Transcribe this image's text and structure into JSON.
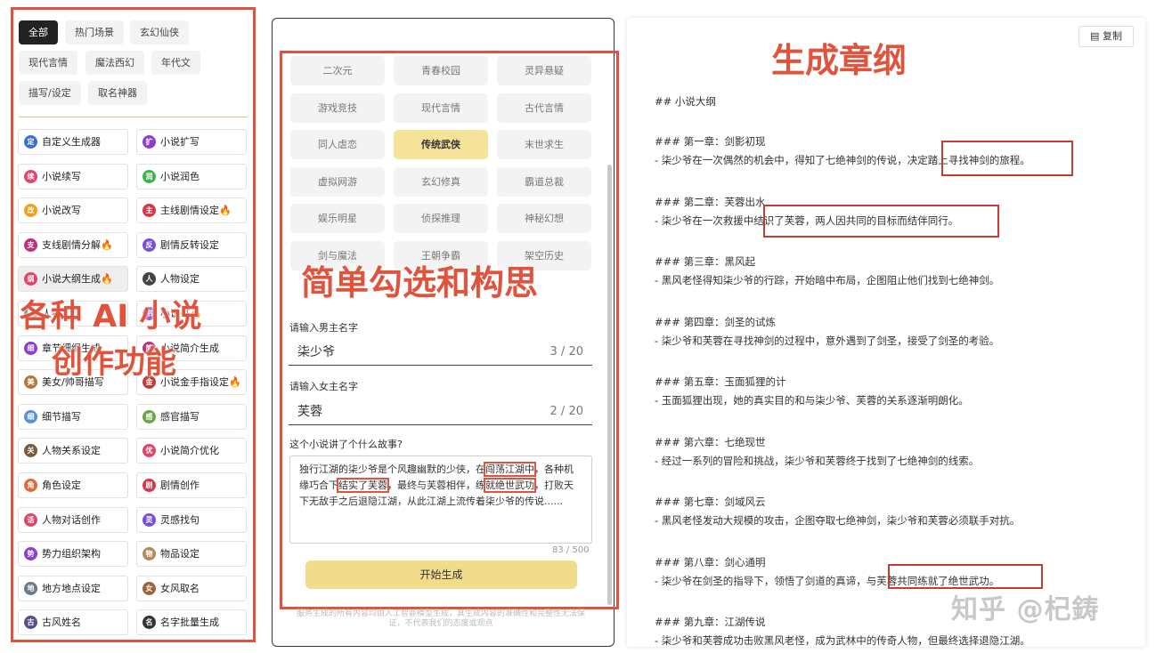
{
  "left": {
    "categories": [
      "全部",
      "热门场景",
      "玄幻仙侠",
      "现代言情",
      "魔法西幻",
      "年代文",
      "描写/设定",
      "取名神器"
    ],
    "tools": [
      {
        "label": "自定义生成器",
        "icon": "定",
        "color": "#3b6ed6"
      },
      {
        "label": "小说扩写",
        "icon": "扩",
        "color": "#8a3fd1"
      },
      {
        "label": "小说续写",
        "icon": "续",
        "color": "#e0446a"
      },
      {
        "label": "小说润色",
        "icon": "润",
        "color": "#3bb54a"
      },
      {
        "label": "小说改写",
        "icon": "改",
        "color": "#f0a01c"
      },
      {
        "label": "主线剧情设定",
        "icon": "主",
        "color": "#d9364a",
        "fire": "🔥"
      },
      {
        "label": "支线剧情分解",
        "icon": "支",
        "color": "#c0307a",
        "fire": "🔥"
      },
      {
        "label": "剧情反转设定",
        "icon": "反",
        "color": "#7a4fd6"
      },
      {
        "label": "小说大纲生成",
        "icon": "纲",
        "color": "#e0446a",
        "fire": "🔥"
      },
      {
        "label": "人物设定",
        "icon": "人",
        "color": "#444"
      },
      {
        "label": "人物",
        "icon": "物",
        "color": "#666"
      },
      {
        "label": "小说书",
        "icon": "书",
        "color": "#9a4fd6",
        "fire": "🔥"
      },
      {
        "label": "章节细纲生成",
        "icon": "细",
        "color": "#8a3fd1"
      },
      {
        "label": "小说简介生成",
        "icon": "简",
        "color": "#c0307a"
      },
      {
        "label": "美女/帅哥描写",
        "icon": "美",
        "color": "#b07a3c"
      },
      {
        "label": "小说金手指设定",
        "icon": "金",
        "color": "#c23a3a",
        "fire": "🔥"
      },
      {
        "label": "细节描写",
        "icon": "细",
        "color": "#5a8fd6"
      },
      {
        "label": "感官描写",
        "icon": "感",
        "color": "#6aa34a"
      },
      {
        "label": "人物关系设定",
        "icon": "关",
        "color": "#7a5a3c"
      },
      {
        "label": "小说简介优化",
        "icon": "优",
        "color": "#e0446a"
      },
      {
        "label": "角色设定",
        "icon": "角",
        "color": "#e06a3c"
      },
      {
        "label": "剧情创作",
        "icon": "剧",
        "color": "#d9364a"
      },
      {
        "label": "人物对话创作",
        "icon": "话",
        "color": "#e0446a"
      },
      {
        "label": "灵感找句",
        "icon": "灵",
        "color": "#7a4fd6"
      },
      {
        "label": "势力组织架构",
        "icon": "势",
        "color": "#8a3fd1"
      },
      {
        "label": "物品设定",
        "icon": "物",
        "color": "#b08a5a"
      },
      {
        "label": "地方地点设定",
        "icon": "地",
        "color": "#6a7a8a"
      },
      {
        "label": "女风取名",
        "icon": "女",
        "color": "#a0603c"
      },
      {
        "label": "古风姓名",
        "icon": "古",
        "color": "#5a4f8a"
      },
      {
        "label": "名字批量生成",
        "icon": "名",
        "color": "#333"
      }
    ],
    "overlay_line1": "各种 AI 小说",
    "overlay_line2": "创作功能"
  },
  "middle": {
    "genres": [
      "二次元",
      "青春校园",
      "灵异悬疑",
      "游戏竞技",
      "现代言情",
      "古代言情",
      "同人虐恋",
      "传统武侠",
      "末世求生",
      "虚拟网游",
      "玄幻修真",
      "霸道总裁",
      "娱乐明星",
      "侦探推理",
      "神秘幻想",
      "剑与魔法",
      "王朝争霸",
      "架空历史"
    ],
    "selected_genre": "传统武侠",
    "overlay": "简单勾选和构思",
    "male_label": "请输入男主名字",
    "male_value": "柒少爷",
    "male_count": "3 / 20",
    "female_label": "请输入女主名字",
    "female_value": "芙蓉",
    "female_count": "2 / 20",
    "story_label": "这个小说讲了个什么故事?",
    "story_p1": "独行江湖的柒少爷是个风趣幽默的少侠，在",
    "story_h1": "闯荡江湖中",
    "story_p2": "，各种机缘巧合下",
    "story_h2": "结实了芙蓉",
    "story_p3": "，最终与芙蓉相伴，练",
    "story_h3": "就绝世武功",
    "story_p4": "，打败天下无敌手之后退隐江湖，从此江湖上流传着柒少爷的传说......",
    "story_count": "83 / 500",
    "generate_label": "开始生成",
    "disclaimer": "服务生成的所有内容均由人工智能模型生成，其生成内容的准确性和完整性无法保证，不代表我们的态度或观点"
  },
  "right": {
    "copy_label": "复制",
    "overlay": "生成章纲",
    "outline_title": "## 小说大纲",
    "chapters": [
      {
        "h": "### 第一章：剑影初现",
        "d": "- 柒少爷在一次偶然的机会中，得知了七绝神剑的传说，决定踏上寻找神剑的旅程。"
      },
      {
        "h": "### 第二章：芙蓉出水",
        "d": "- 柒少爷在一次救援中结识了芙蓉，两人因共同的目标而结伴同行。"
      },
      {
        "h": "### 第三章：黑风起",
        "d": "- 黑风老怪得知柒少爷的行踪，开始暗中布局，企图阻止他们找到七绝神剑。"
      },
      {
        "h": "### 第四章：剑圣的试炼",
        "d": "- 柒少爷和芙蓉在寻找神剑的过程中，意外遇到了剑圣，接受了剑圣的考验。"
      },
      {
        "h": "### 第五章：玉面狐狸的计",
        "d": "- 玉面狐狸出现，她的真实目的和与柒少爷、芙蓉的关系逐渐明朗化。"
      },
      {
        "h": "### 第六章：七绝现世",
        "d": "- 经过一系列的冒险和挑战，柒少爷和芙蓉终于找到了七绝神剑的线索。"
      },
      {
        "h": "### 第七章：剑域风云",
        "d": "- 黑风老怪发动大规模的攻击，企图夺取七绝神剑，柒少爷和芙蓉必须联手对抗。"
      },
      {
        "h": "### 第八章：剑心通明",
        "d": "- 柒少爷在剑圣的指导下，领悟了剑道的真谛，与芙蓉共同练就了绝世武功。"
      },
      {
        "h": "### 第九章：江湖传说",
        "d": "- 柒少爷和芙蓉成功击败黑风老怪，成为武林中的传奇人物，但最终选择退隐江湖。"
      }
    ],
    "watermark": "知乎 @杞鋳"
  }
}
